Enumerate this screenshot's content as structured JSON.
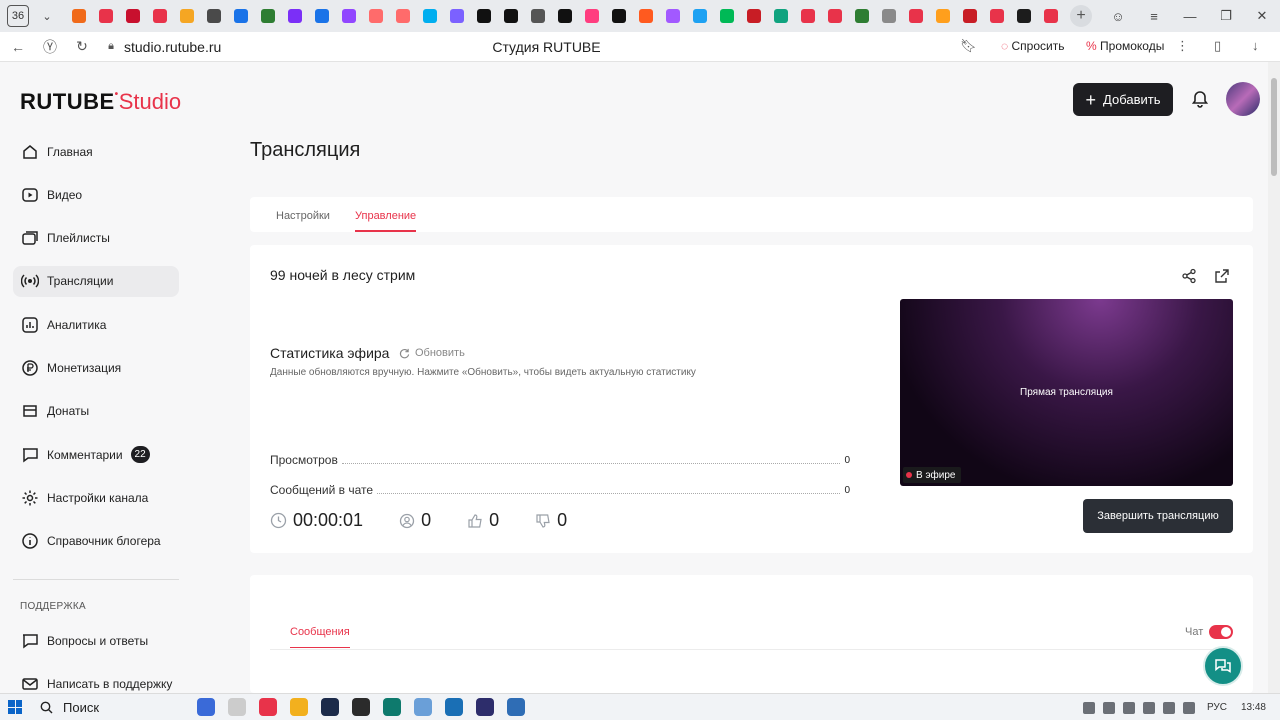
{
  "browser": {
    "tab_count": "36",
    "url": "studio.rutube.ru",
    "page_title": "Студия RUTUBE",
    "ask_label": "Спросить",
    "promo_label": "Промокоды",
    "favicons": [
      "#f06a1a",
      "#e8334a",
      "#c8102e",
      "#e8334a",
      "#f5a623",
      "#4a4a4a",
      "#1a73e8",
      "#2e7d32",
      "#7b2ff7",
      "#1a73e8",
      "#9146ff",
      "#ff6b6b",
      "#ff6b6b",
      "#00aeef",
      "#7b61ff",
      "#111111",
      "#111111",
      "#555555",
      "#111111",
      "#ff3d7f",
      "#111111",
      "#ff5a1f",
      "#a259ff",
      "#1da1f2",
      "#00b956",
      "#c81d25",
      "#10a37f",
      "#e8334a",
      "#e8334a",
      "#2e7d32",
      "#8a8a8a",
      "#e8334a",
      "#ff9f1c",
      "#c81d25",
      "#e8334a",
      "#1c1c1c",
      "#e8334a"
    ]
  },
  "brand": {
    "logo_main": "RUTUBE",
    "logo_studio": "Studio"
  },
  "header": {
    "add_button": "Добавить"
  },
  "sidebar": {
    "items": [
      {
        "label": "Главная",
        "icon": "home-icon"
      },
      {
        "label": "Видео",
        "icon": "video-icon"
      },
      {
        "label": "Плейлисты",
        "icon": "playlist-icon"
      },
      {
        "label": "Трансляции",
        "icon": "broadcast-icon",
        "active": true
      },
      {
        "label": "Аналитика",
        "icon": "analytics-icon"
      },
      {
        "label": "Монетизация",
        "icon": "monetization-icon"
      },
      {
        "label": "Донаты",
        "icon": "donations-icon"
      },
      {
        "label": "Комментарии",
        "icon": "comments-icon",
        "badge": "22"
      },
      {
        "label": "Настройки канала",
        "icon": "gear-icon"
      },
      {
        "label": "Справочник блогера",
        "icon": "info-icon"
      }
    ],
    "support_title": "ПОДДЕРЖКА",
    "support_items": [
      {
        "label": "Вопросы и ответы",
        "icon": "question-icon"
      },
      {
        "label": "Написать в поддержку",
        "icon": "mail-icon"
      }
    ]
  },
  "main": {
    "title": "Трансляция",
    "tabs": [
      {
        "label": "Настройки"
      },
      {
        "label": "Управление",
        "active": true
      }
    ],
    "stream": {
      "name": "99 ночей в лесу стрим",
      "stats_title": "Статистика эфира",
      "refresh_label": "Обновить",
      "stats_hint": "Данные обновляются вручную. Нажмите «Обновить», чтобы видеть актуальную статистику",
      "stats": [
        {
          "label": "Просмотров",
          "value": "0"
        },
        {
          "label": "Сообщений в чате",
          "value": "0"
        }
      ],
      "preview_label": "Прямая трансляция",
      "live_label": "В эфире",
      "timer": "00:00:01",
      "viewers": "0",
      "likes": "0",
      "dislikes": "0",
      "end_button": "Завершить трансляцию"
    },
    "chat": {
      "tab_label": "Сообщения",
      "toggle_label": "Чат",
      "toggle_on": true
    }
  },
  "taskbar": {
    "search_label": "Поиск",
    "lang": "РУС",
    "time": "13:48",
    "apps": [
      "#3a6ad8",
      "#cccccc",
      "#e8334a",
      "#f2b01e",
      "#1c2b4a",
      "#2b2b2b",
      "#0e7a6d",
      "#6a9fd8",
      "#1a6fb5",
      "#2d2d6b",
      "#2f6db5"
    ]
  },
  "colors": {
    "accent": "#e8334a",
    "dark_button": "#1e1e22",
    "help_fab": "#138f86"
  }
}
